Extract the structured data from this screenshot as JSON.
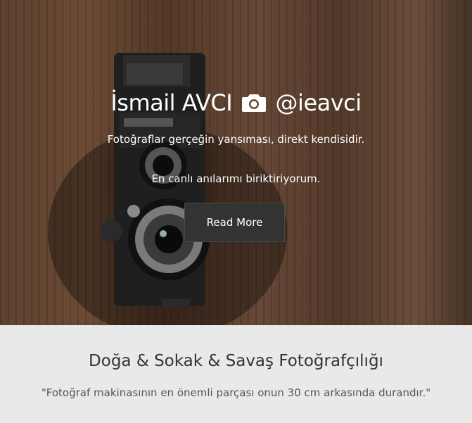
{
  "hero": {
    "title_name": "İsmail AVCI",
    "title_handle": "@ieavci",
    "title_icon": "camera-icon",
    "line1": "Fotoğraflar gerçeğin yansıması, direkt kendisidir.",
    "line2": "En canlı anılarımı biriktiriyorum.",
    "button_label": "Read More"
  },
  "section": {
    "title": "Doğa & Sokak & Savaş Fotoğrafçılığı",
    "quote": "\"Fotoğraf makinasının en önemli parçası onun 30 cm arkasında durandır.\""
  },
  "colors": {
    "button_bg": "#333333",
    "section_bg": "#e9e9e9",
    "hero_text": "#ffffff"
  }
}
